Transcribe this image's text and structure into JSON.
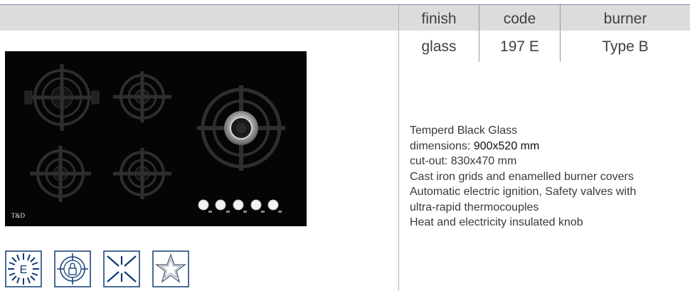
{
  "spec_table": {
    "headers": [
      "finish",
      "code",
      "burner"
    ],
    "values": [
      "glass",
      "197 E",
      "Type B"
    ]
  },
  "product": {
    "brand_mark": "T&D"
  },
  "description": {
    "line1": "Temperd Black Glass",
    "dimensions_label": "dimensions: ",
    "dimensions_value": "900x520 mm",
    "line3": "cut-out: 830x470 mm",
    "line4": "Cast iron grids and enamelled burner covers",
    "line5": "Automatic electric ignition, Safety valves with",
    "line6": "ultra-rapid thermocouples",
    "line7": "Heat and electricity insulated knob"
  },
  "certifications": {
    "energy_letter": "E",
    "icons": [
      "energy-class-icon",
      "gas-safety-lock-icon",
      "electric-ignition-icon",
      "quality-star-icon"
    ]
  },
  "colors": {
    "glass": "#050505",
    "header_band": "#dcdcdc",
    "icon_blue": "#0e3a73"
  }
}
